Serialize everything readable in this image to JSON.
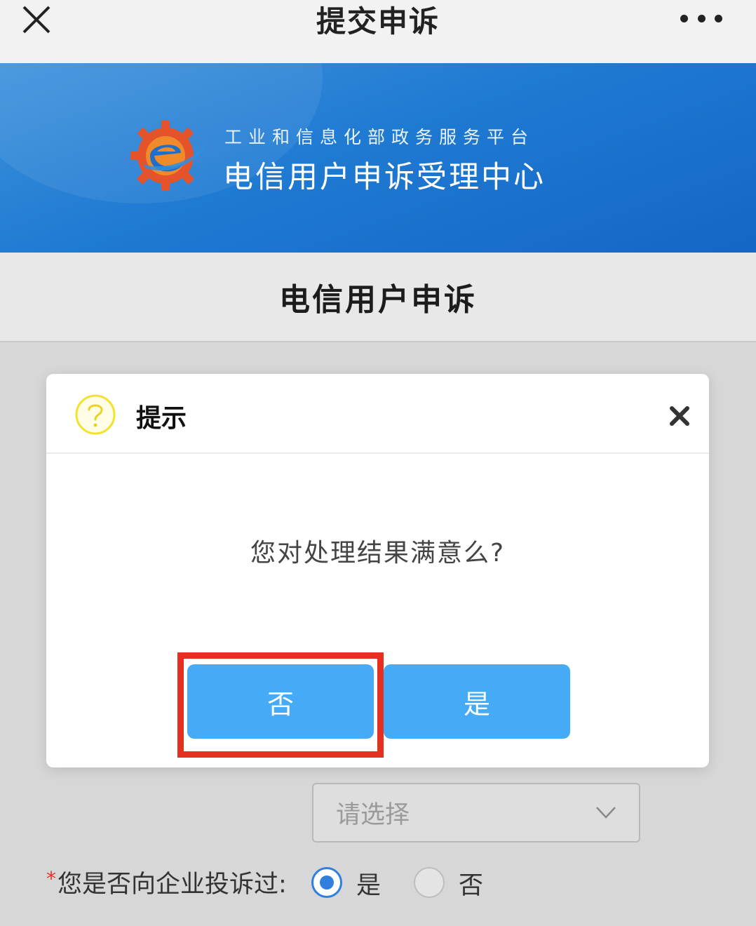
{
  "navbar": {
    "title": "提交申诉",
    "close_icon": "close-icon",
    "more_icon": "more-icon"
  },
  "banner": {
    "subtitle": "工业和信息化部政务服务平台",
    "title": "电信用户申诉受理中心",
    "logo_icon": "gear-e-logo"
  },
  "section": {
    "heading": "电信用户申诉"
  },
  "modal": {
    "title": "提示",
    "icon": "question-icon",
    "close_icon": "close-icon",
    "message": "您对处理结果满意么?",
    "no_label": "否",
    "yes_label": "是"
  },
  "form": {
    "select": {
      "placeholder": "请选择",
      "chevron_icon": "chevron-down-icon"
    },
    "complained_question": {
      "required_mark": "*",
      "label": "您是否向企业投诉过:",
      "options": [
        "是",
        "否"
      ],
      "selected": "是"
    }
  },
  "colors": {
    "banner_blue": "#1f7ad2",
    "button_blue": "#45abf6",
    "highlight_red": "#e3301f",
    "radio_blue": "#2f7fe0",
    "icon_yellow": "#f2e22b"
  }
}
